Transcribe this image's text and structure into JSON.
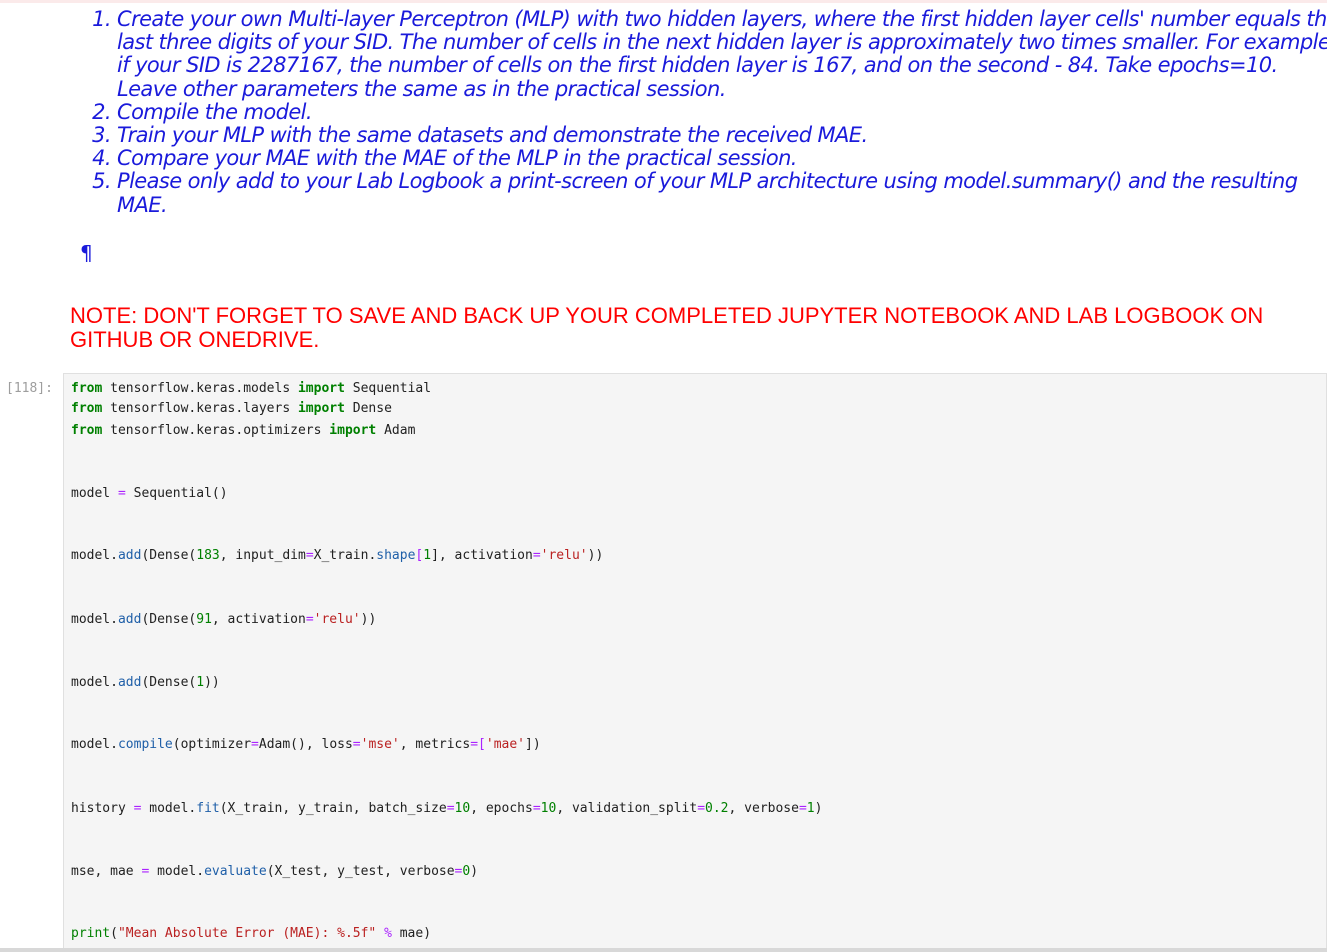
{
  "tasks": [
    "Create your own Multi-layer Perceptron (MLP) with two hidden layers, where the first hidden layer cells' number equals the last three digits of your SID. The number of cells in the next hidden layer is approximately two times smaller. For example, if your SID is 2287167, the number of cells on the first hidden layer is 167, and on the second - 84. Take epochs=10. Leave other parameters the same as in the practical session.",
    "Compile the model.",
    "Train your MLP with the same datasets and demonstrate the received MAE.",
    "Compare your MAE with the MAE of the MLP in the practical session.",
    "Please only add to your Lab Logbook a print-screen of your MLP architecture using model.summary() and the resulting MAE."
  ],
  "pilcrow": "¶",
  "note": "NOTE: DON'T FORGET TO SAVE AND BACK UP YOUR COMPLETED JUPYTER NOTEBOOK AND LAB LOGBOOK ON GITHUB OR ONEDRIVE.",
  "cell": {
    "prompt": "[118]:",
    "lines": {
      "l1": {
        "kw1": "from",
        "t1": " tensorflow.keras.models ",
        "kw2": "import",
        "t2": " Sequential"
      },
      "l2": {
        "kw1": "from",
        "t1": " tensorflow.keras.layers ",
        "kw2": "import",
        "t2": " Dense"
      },
      "l3": {
        "kw1": "from",
        "t1": " tensorflow.keras.optimizers ",
        "kw2": "import",
        "t2": " Adam"
      },
      "l4": {
        "a": "model ",
        "op": "=",
        "b": " Sequential()"
      },
      "l5": {
        "a": "model.",
        "fn": "add",
        "b": "(Dense(",
        "n1": "183",
        "c": ", input_dim",
        "op": "=",
        "d": "X_train.",
        "fn2": "shape",
        "e": "[",
        "n2": "1",
        "f": "], activation",
        "op2": "=",
        "s": "'relu'",
        "g": "))"
      },
      "l6": {
        "a": "model.",
        "fn": "add",
        "b": "(Dense(",
        "n1": "91",
        "c": ", activation",
        "op": "=",
        "s": "'relu'",
        "g": "))"
      },
      "l7": {
        "a": "model.",
        "fn": "add",
        "b": "(Dense(",
        "n1": "1",
        "g": "))"
      },
      "l8": {
        "a": "model.",
        "fn": "compile",
        "b": "(optimizer",
        "op": "=",
        "c": "Adam(), loss",
        "op2": "=",
        "s1": "'mse'",
        "d": ", metrics",
        "op3": "=",
        "e": "[",
        "s2": "'mae'",
        "f": "])"
      },
      "l9": {
        "a": "history ",
        "op": "=",
        "b": " model.",
        "fn": "fit",
        "c": "(X_train, y_train, batch_size",
        "op2": "=",
        "n1": "10",
        "d": ", epochs",
        "op3": "=",
        "n2": "10",
        "e": ", validation_split",
        "op4": "=",
        "n3": "0.2",
        "f": ", verbose",
        "op5": "=",
        "n4": "1",
        "g": ")"
      },
      "l10": {
        "a": "mse, mae ",
        "op": "=",
        "b": " model.",
        "fn": "evaluate",
        "c": "(X_test, y_test, verbose",
        "op2": "=",
        "n1": "0",
        "g": ")"
      },
      "l11": {
        "fn": "print",
        "a": "(",
        "s": "\"Mean Absolute Error (MAE): %.5f\"",
        "op": " % ",
        "b": "mae)"
      }
    }
  }
}
